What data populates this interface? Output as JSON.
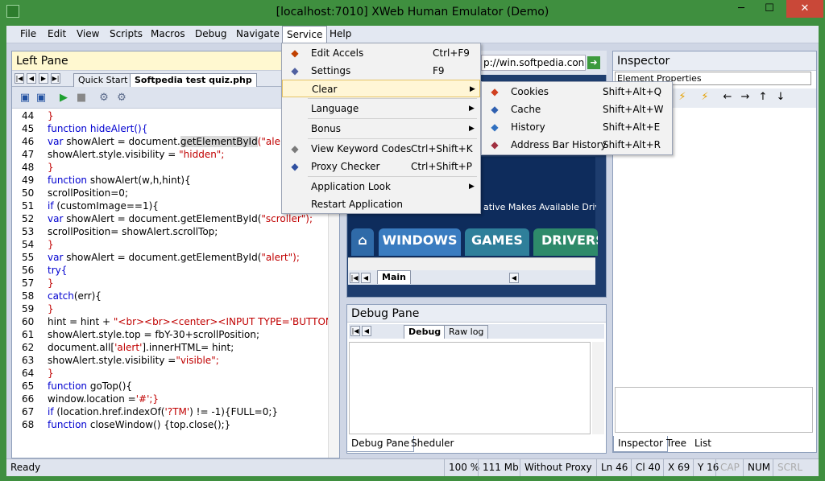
{
  "window": {
    "title": "[localhost:7010] XWeb Human Emulator (Demo)",
    "minimize": "─",
    "maximize": "☐",
    "close": "✕"
  },
  "menubar": [
    "File",
    "Edit",
    "View",
    "Scripts",
    "Macros",
    "Debug",
    "Navigate",
    "Service",
    "Help"
  ],
  "service_menu": {
    "items": [
      {
        "label": "Edit Accels",
        "shortcut": "Ctrl+F9",
        "icon": "edit-accels-icon"
      },
      {
        "label": "Settings",
        "shortcut": "F9",
        "icon": "settings-icon"
      },
      {
        "label": "Clear",
        "shortcut": "",
        "submenu": true
      },
      {
        "label": "Language",
        "shortcut": "",
        "submenu": true
      },
      {
        "label": "Bonus",
        "shortcut": "",
        "submenu": true
      },
      {
        "label": "View Keyword Codes",
        "shortcut": "Ctrl+Shift+K",
        "icon": "keyboard-icon"
      },
      {
        "label": "Proxy Checker",
        "shortcut": "Ctrl+Shift+P",
        "icon": "proxy-icon"
      },
      {
        "label": "Application Look",
        "shortcut": "",
        "submenu": true
      },
      {
        "label": "Restart Application",
        "shortcut": ""
      }
    ]
  },
  "clear_submenu": {
    "items": [
      {
        "label": "Cookies",
        "shortcut": "Shift+Alt+Q",
        "icon": "cookies-icon"
      },
      {
        "label": "Cache",
        "shortcut": "Shift+Alt+W",
        "icon": "cache-icon"
      },
      {
        "label": "History",
        "shortcut": "Shift+Alt+E",
        "icon": "history-icon"
      },
      {
        "label": "Address Bar History",
        "shortcut": "Shift+Alt+R",
        "icon": "address-history-icon"
      }
    ]
  },
  "left_pane": {
    "title": "Left Pane",
    "tabs": [
      "Quick Start",
      "Softpedia test quiz.php"
    ],
    "lines": [
      {
        "n": "44",
        "parts": [
          {
            "t": "}",
            "c": "str"
          }
        ]
      },
      {
        "n": "45",
        "parts": [
          {
            "t": "function ",
            "c": "kw"
          },
          {
            "t": "hideAlert(){",
            "c": "kw"
          }
        ]
      },
      {
        "n": "46",
        "parts": [
          {
            "t": "var ",
            "c": "kw"
          },
          {
            "t": "showAlert = document.",
            "c": "plain"
          },
          {
            "t": "getElementById",
            "c": "plain"
          },
          {
            "t": "(\"alert\")",
            "c": "str"
          }
        ]
      },
      {
        "n": "47",
        "parts": [
          {
            "t": "showAlert.style.visibility = ",
            "c": "plain"
          },
          {
            "t": "\"hidden\";",
            "c": "str"
          }
        ]
      },
      {
        "n": "48",
        "parts": [
          {
            "t": "}",
            "c": "str"
          }
        ]
      },
      {
        "n": "49",
        "parts": [
          {
            "t": "function ",
            "c": "kw"
          },
          {
            "t": "showAlert(w,h,hint){",
            "c": "plain"
          }
        ]
      },
      {
        "n": "50",
        "parts": [
          {
            "t": "scrollPosition=0;",
            "c": "plain"
          }
        ]
      },
      {
        "n": "51",
        "parts": [
          {
            "t": "if ",
            "c": "kw"
          },
          {
            "t": "(customImage==1){",
            "c": "plain"
          }
        ]
      },
      {
        "n": "52",
        "parts": [
          {
            "t": "var ",
            "c": "kw"
          },
          {
            "t": "showAlert = document.getElementById(",
            "c": "plain"
          },
          {
            "t": "\"scroller\");",
            "c": "str"
          }
        ]
      },
      {
        "n": "53",
        "parts": [
          {
            "t": "scrollPosition= showAlert.scrollTop;",
            "c": "plain"
          }
        ]
      },
      {
        "n": "54",
        "parts": [
          {
            "t": "}",
            "c": "str"
          }
        ]
      },
      {
        "n": "55",
        "parts": [
          {
            "t": "var ",
            "c": "kw"
          },
          {
            "t": "showAlert = document.getElementById(",
            "c": "plain"
          },
          {
            "t": "\"alert\");",
            "c": "str"
          }
        ]
      },
      {
        "n": "56",
        "parts": [
          {
            "t": "try{",
            "c": "kw"
          }
        ]
      },
      {
        "n": "57",
        "parts": [
          {
            "t": "}",
            "c": "str"
          }
        ]
      },
      {
        "n": "58",
        "parts": [
          {
            "t": "catch",
            "c": "kw"
          },
          {
            "t": "(err){",
            "c": "plain"
          }
        ]
      },
      {
        "n": "59",
        "parts": [
          {
            "t": "}",
            "c": "str"
          }
        ]
      },
      {
        "n": "60",
        "parts": [
          {
            "t": "hint = hint + ",
            "c": "plain"
          },
          {
            "t": "\"<br><br><center><INPUT TYPE='BUTTON' V",
            "c": "str"
          }
        ]
      },
      {
        "n": "61",
        "parts": [
          {
            "t": "showAlert.style.top = fbY-30+scrollPosition;",
            "c": "plain"
          }
        ]
      },
      {
        "n": "62",
        "parts": [
          {
            "t": "document.all[",
            "c": "plain"
          },
          {
            "t": "'alert'",
            "c": "str"
          },
          {
            "t": "].innerHTML= hint;",
            "c": "plain"
          }
        ]
      },
      {
        "n": "63",
        "parts": [
          {
            "t": "showAlert.style.visibility =",
            "c": "plain"
          },
          {
            "t": "\"visible\";",
            "c": "str"
          }
        ]
      },
      {
        "n": "64",
        "parts": [
          {
            "t": "}",
            "c": "str"
          }
        ]
      },
      {
        "n": "65",
        "parts": [
          {
            "t": "function ",
            "c": "kw"
          },
          {
            "t": "goTop(){",
            "c": "plain"
          }
        ]
      },
      {
        "n": "66",
        "parts": [
          {
            "t": "window.location =",
            "c": "plain"
          },
          {
            "t": "'#';}",
            "c": "str"
          }
        ]
      },
      {
        "n": "67",
        "parts": [
          {
            "t": "if ",
            "c": "kw"
          },
          {
            "t": "(location.href.indexOf(",
            "c": "plain"
          },
          {
            "t": "'?TM'",
            "c": "str"
          },
          {
            "t": ") != -1){FULL=0;}",
            "c": "plain"
          }
        ]
      },
      {
        "n": "68",
        "parts": [
          {
            "t": "function ",
            "c": "kw"
          },
          {
            "t": "closeWindow() {top.close();}",
            "c": "plain"
          }
        ]
      }
    ]
  },
  "browser": {
    "url": "p://win.softpedia.con",
    "promo": "ative Makes Available Driver",
    "site_tabs": [
      "WINDOWS",
      "GAMES",
      "DRIVERS"
    ],
    "bottom_tab": "Main"
  },
  "debug_pane": {
    "title": "Debug Pane",
    "tabs": [
      "Debug",
      "Raw log"
    ],
    "bottom_tabs": [
      "Debug Pane",
      "Sheduler"
    ]
  },
  "inspector": {
    "title": "Inspector",
    "combo": "Element Properties",
    "bottom_tabs": [
      "Inspector",
      "Tree",
      "List"
    ]
  },
  "status": {
    "ready": "Ready",
    "zoom": "100 %",
    "memory": "111 Mb",
    "proxy": "Without Proxy",
    "line": "Ln 46",
    "col": "Cl 40",
    "x": "X 69",
    "y": "Y 16",
    "cap": "CAP",
    "num": "NUM",
    "scrl": "SCRL"
  }
}
